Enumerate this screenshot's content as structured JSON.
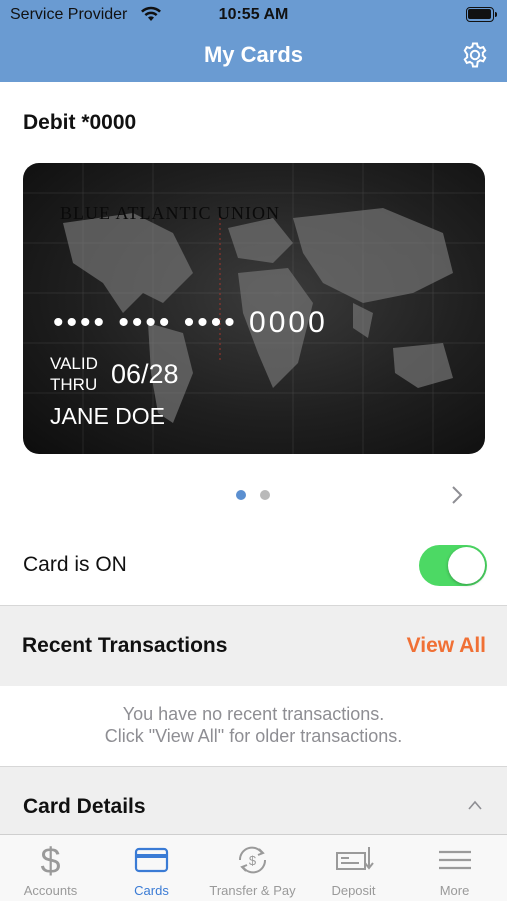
{
  "status_bar": {
    "carrier": "Service Provider",
    "time": "10:55 AM"
  },
  "header": {
    "title": "My Cards",
    "settings_icon": "gear-icon",
    "background": "#6a9bd2"
  },
  "card": {
    "label": "Debit *0000",
    "masked_number": "•••• •••• •••• 0000",
    "valid_thru_label": "VALID\nTHRU",
    "expiry": "06/28",
    "holder_name": "JANE DOE",
    "logo_text": "BLUE ATLANTIC UNION"
  },
  "pager": {
    "count": 2,
    "active_index": 0,
    "active_color": "#5b8fd0",
    "inactive_color": "#b9b9b9"
  },
  "card_status": {
    "label": "Card is ON",
    "enabled": true,
    "toggle_color": "#4cd964"
  },
  "recent_transactions": {
    "title": "Recent Transactions",
    "view_all_label": "View All",
    "empty_line1": "You have no recent transactions.",
    "empty_line2": "Click \"View All\" for older transactions.",
    "accent": "#f07035"
  },
  "card_details": {
    "title": "Card Details",
    "expanded": true
  },
  "tabbar": {
    "active_color": "#3a7bd5",
    "tabs": [
      {
        "label": "Accounts",
        "icon": "dollar-icon",
        "active": false
      },
      {
        "label": "Cards",
        "icon": "credit-card-icon",
        "active": true
      },
      {
        "label": "Transfer & Pay",
        "icon": "transfer-icon",
        "active": false
      },
      {
        "label": "Deposit",
        "icon": "check-deposit-icon",
        "active": false
      },
      {
        "label": "More",
        "icon": "menu-icon",
        "active": false
      }
    ]
  }
}
